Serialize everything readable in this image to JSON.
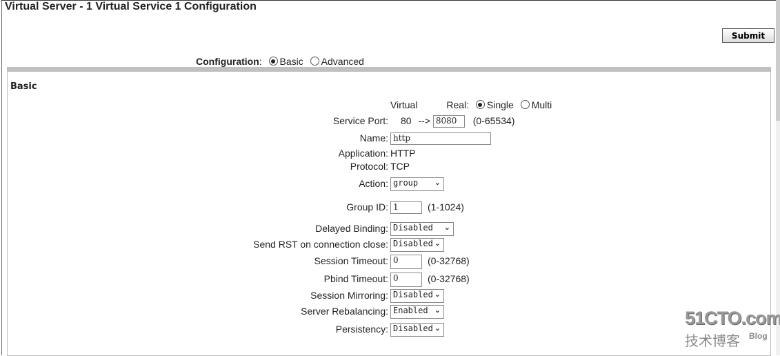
{
  "title": "Virtual Server - 1 Virtual Service 1 Configuration",
  "submit_label": "Submit",
  "configuration": {
    "label": "Configuration",
    "options": [
      "Basic",
      "Advanced"
    ],
    "selected": "Basic"
  },
  "section_title": "Basic",
  "port_header": {
    "virtual": "Virtual",
    "real": "Real:",
    "options": [
      "Single",
      "Multi"
    ],
    "selected": "Single"
  },
  "fields": {
    "service_port": {
      "label": "Service Port:",
      "virtual": "80",
      "arrow": "-->",
      "real": "8080",
      "hint": "(0-65534)"
    },
    "name": {
      "label": "Name:",
      "value": "http"
    },
    "application": {
      "label": "Application:",
      "value": "HTTP"
    },
    "protocol": {
      "label": "Protocol:",
      "value": "TCP"
    },
    "action": {
      "label": "Action:",
      "value": "group"
    },
    "group_id": {
      "label": "Group ID:",
      "value": "1",
      "hint": "(1-1024)"
    },
    "delayed_binding": {
      "label": "Delayed Binding:",
      "value": "Disabled"
    },
    "send_rst": {
      "label": "Send RST on connection close:",
      "value": "Disabled"
    },
    "session_timeout": {
      "label": "Session Timeout:",
      "value": "0",
      "hint": "(0-32768)"
    },
    "pbind_timeout": {
      "label": "Pbind Timeout:",
      "value": "0",
      "hint": "(0-32768)"
    },
    "session_mirroring": {
      "label": "Session Mirroring:",
      "value": "Disabled"
    },
    "server_rebalancing": {
      "label": "Server Rebalancing:",
      "value": "Enabled"
    },
    "persistency": {
      "label": "Persistency:",
      "value": "Disabled"
    }
  },
  "watermark": {
    "site": "51CTO.com",
    "sub": "技术博客",
    "blog": "Blog"
  }
}
